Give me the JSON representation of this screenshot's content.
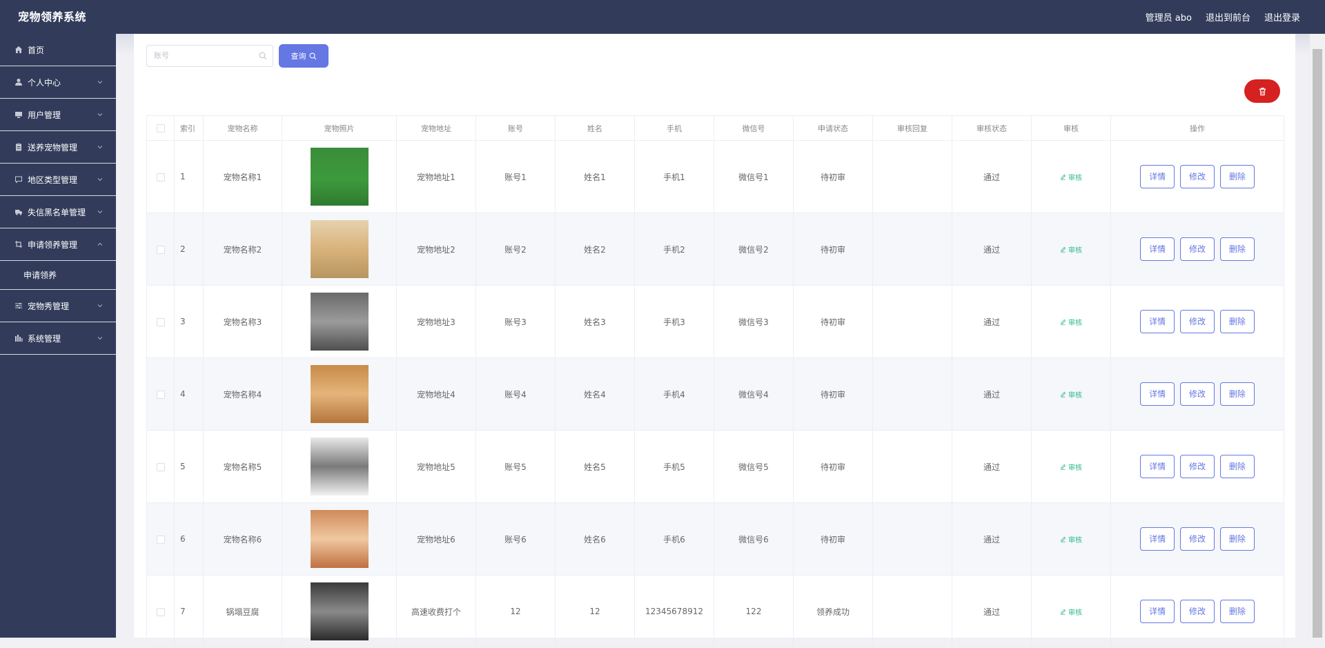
{
  "app": {
    "title": "宠物领养系统"
  },
  "header": {
    "admin": "管理员 abo",
    "to_front": "退出到前台",
    "logout": "退出登录"
  },
  "sidebar": {
    "items": [
      {
        "label": "首页",
        "icon": "home-icon"
      },
      {
        "label": "个人中心",
        "icon": "user-icon"
      },
      {
        "label": "用户管理",
        "icon": "monitor-icon"
      },
      {
        "label": "送养宠物管理",
        "icon": "clipboard-icon"
      },
      {
        "label": "地区类型管理",
        "icon": "chat-icon"
      },
      {
        "label": "失信黑名单管理",
        "icon": "truck-icon"
      },
      {
        "label": "申请领养管理",
        "icon": "crop-icon"
      },
      {
        "label": "宠物秀管理",
        "icon": "sliders-icon"
      },
      {
        "label": "系统管理",
        "icon": "chart-icon"
      }
    ],
    "sub": {
      "label": "申请领养"
    }
  },
  "search": {
    "placeholder": "账号",
    "query_label": "查询"
  },
  "table": {
    "headers": [
      "索引",
      "宠物名称",
      "宠物照片",
      "宠物地址",
      "账号",
      "姓名",
      "手机",
      "微信号",
      "申请状态",
      "审核回复",
      "审核状态",
      "审核",
      "操作"
    ],
    "audit_label": "审核",
    "actions": {
      "detail": "详情",
      "edit": "修改",
      "delete": "删除"
    },
    "rows": [
      {
        "idx": "1",
        "name": "宠物名称1",
        "addr": "宠物地址1",
        "account": "账号1",
        "realname": "姓名1",
        "phone": "手机1",
        "wechat": "微信号1",
        "apply_status": "待初审",
        "reply": "",
        "review_status": "通过"
      },
      {
        "idx": "2",
        "name": "宠物名称2",
        "addr": "宠物地址2",
        "account": "账号2",
        "realname": "姓名2",
        "phone": "手机2",
        "wechat": "微信号2",
        "apply_status": "待初审",
        "reply": "",
        "review_status": "通过"
      },
      {
        "idx": "3",
        "name": "宠物名称3",
        "addr": "宠物地址3",
        "account": "账号3",
        "realname": "姓名3",
        "phone": "手机3",
        "wechat": "微信号3",
        "apply_status": "待初审",
        "reply": "",
        "review_status": "通过"
      },
      {
        "idx": "4",
        "name": "宠物名称4",
        "addr": "宠物地址4",
        "account": "账号4",
        "realname": "姓名4",
        "phone": "手机4",
        "wechat": "微信号4",
        "apply_status": "待初审",
        "reply": "",
        "review_status": "通过"
      },
      {
        "idx": "5",
        "name": "宠物名称5",
        "addr": "宠物地址5",
        "account": "账号5",
        "realname": "姓名5",
        "phone": "手机5",
        "wechat": "微信号5",
        "apply_status": "待初审",
        "reply": "",
        "review_status": "通过"
      },
      {
        "idx": "6",
        "name": "宠物名称6",
        "addr": "宠物地址6",
        "account": "账号6",
        "realname": "姓名6",
        "phone": "手机6",
        "wechat": "微信号6",
        "apply_status": "待初审",
        "reply": "",
        "review_status": "通过"
      },
      {
        "idx": "7",
        "name": "锅塌豆腐",
        "addr": "高速收费打个",
        "account": "12",
        "realname": "12",
        "phone": "12345678912",
        "wechat": "122",
        "apply_status": "领养成功",
        "reply": "",
        "review_status": "通过"
      }
    ]
  },
  "colors": {
    "primary": "#6477e3",
    "danger": "#d62121",
    "sidebar": "#323c5a",
    "audit": "#2bb78d"
  }
}
